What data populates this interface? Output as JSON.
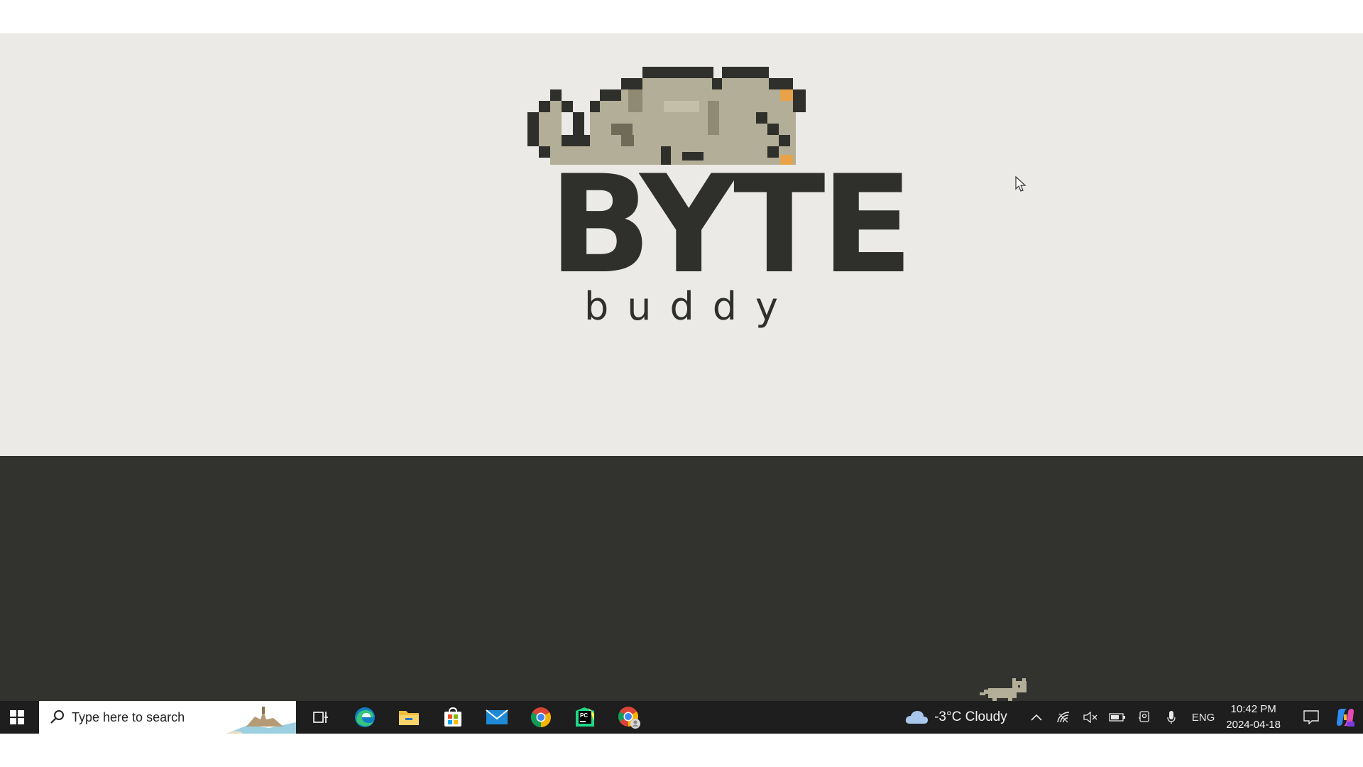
{
  "logo": {
    "word": "BYTE",
    "sub": "buddy"
  },
  "taskbar": {
    "search_placeholder": "Type here to search",
    "apps": [
      {
        "name": "task-view-icon"
      },
      {
        "name": "edge-icon"
      },
      {
        "name": "file-explorer-icon"
      },
      {
        "name": "microsoft-store-icon"
      },
      {
        "name": "mail-icon"
      },
      {
        "name": "chrome-icon"
      },
      {
        "name": "pycharm-icon"
      },
      {
        "name": "chrome-profile-icon"
      }
    ]
  },
  "tray": {
    "weather": "-3°C  Cloudy",
    "language": "ENG",
    "time": "10:42 PM",
    "date": "2024-04-18"
  },
  "colors": {
    "light_panel": "#ebeae6",
    "dark_panel": "#32332e",
    "taskbar": "#1d1e1d",
    "logo_ink": "#2f302b",
    "cat_fur": "#b3ae97",
    "cat_accent": "#e8a24a"
  }
}
